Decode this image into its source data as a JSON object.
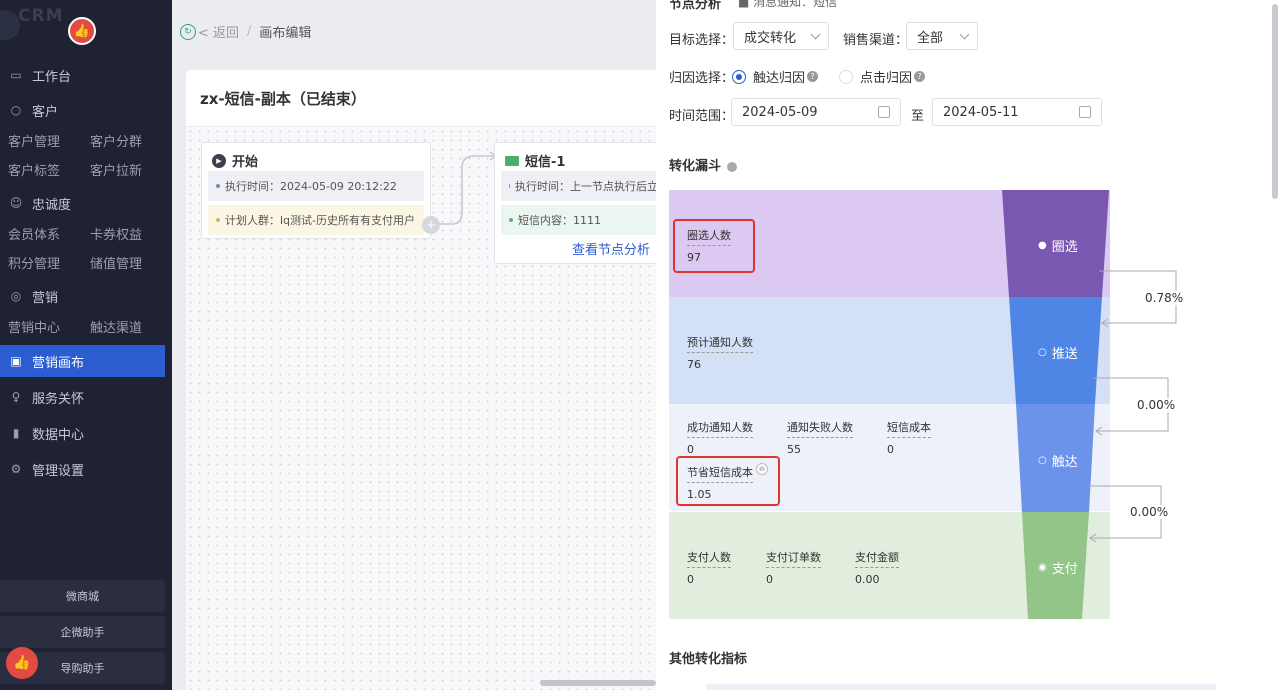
{
  "sidebar": {
    "logo": "CRM",
    "menu": {
      "workbench": "工作台",
      "customer": "客户",
      "customer_manage": "客户管理",
      "customer_segment": "客户分群",
      "customer_tag": "客户标签",
      "customer_new": "客户拉新",
      "loyalty": "忠诚度",
      "member_system": "会员体系",
      "coupon_rights": "卡券权益",
      "points_manage": "积分管理",
      "stored_value": "储值管理",
      "marketing": "营销",
      "marketing_center": "营销中心",
      "reach_channel": "触达渠道",
      "marketing_canvas": "营销画布",
      "service_care": "服务关怀",
      "data_center": "数据中心",
      "settings": "管理设置"
    },
    "bottom_buttons": [
      "微商城",
      "企微助手",
      "导购助手"
    ]
  },
  "breadcrumb": {
    "back": "< 返回",
    "current": "画布编辑"
  },
  "board": {
    "title": "zx-短信-副本（已结束）",
    "start_node": {
      "title": "开始",
      "exec_time": "执行时间：2024-05-09 20:12:22",
      "crowd": "计划人群：lq测试-历史所有有支付用户"
    },
    "sms_node": {
      "title": "短信-1",
      "exec_time": "执行时间：上一节点执行后立",
      "content": "短信内容：1111",
      "link": "查看节点分析"
    }
  },
  "panel": {
    "header_partial": "节点分析",
    "notify_partial": "消息通知：短信",
    "target_label": "目标选择：",
    "target_value": "成交转化",
    "channel_label": "销售渠道：",
    "channel_value": "全部",
    "attribution_label": "归因选择：",
    "attr_reach": "触达归因",
    "attr_click": "点击归因",
    "time_label": "时间范围：",
    "date_from": "2024-05-09",
    "date_to_sep": "至",
    "date_to": "2024-05-11",
    "funnel_title": "转化漏斗",
    "other_title": "其他转化指标"
  },
  "funnel": {
    "colors": {
      "circle_bg": "#dcc9f2",
      "circle": "#7a57b0",
      "push_bg": "#d4e0f6",
      "push": "#4f86e6",
      "reach_bg": "#eef1fa",
      "reach": "#6b93ea",
      "pay_bg": "#e1eedd",
      "pay": "#93c589"
    },
    "stages": [
      {
        "name": "圈选",
        "metrics": [
          {
            "label": "圈选人数",
            "value": "97"
          }
        ]
      },
      {
        "name": "推送",
        "metrics": [
          {
            "label": "预计通知人数",
            "value": "76"
          }
        ]
      },
      {
        "name": "触达",
        "metrics": [
          {
            "label": "成功通知人数",
            "value": "0"
          },
          {
            "label": "通知失败人数",
            "value": "55"
          },
          {
            "label": "短信成本",
            "value": "0"
          },
          {
            "label": "节省短信成本",
            "value": "1.05"
          }
        ]
      },
      {
        "name": "支付",
        "metrics": [
          {
            "label": "支付人数",
            "value": "0"
          },
          {
            "label": "支付订单数",
            "value": "0"
          },
          {
            "label": "支付金额",
            "value": "0.00"
          }
        ]
      }
    ],
    "rates": [
      "0.78%",
      "0.00%",
      "0.00%"
    ]
  }
}
